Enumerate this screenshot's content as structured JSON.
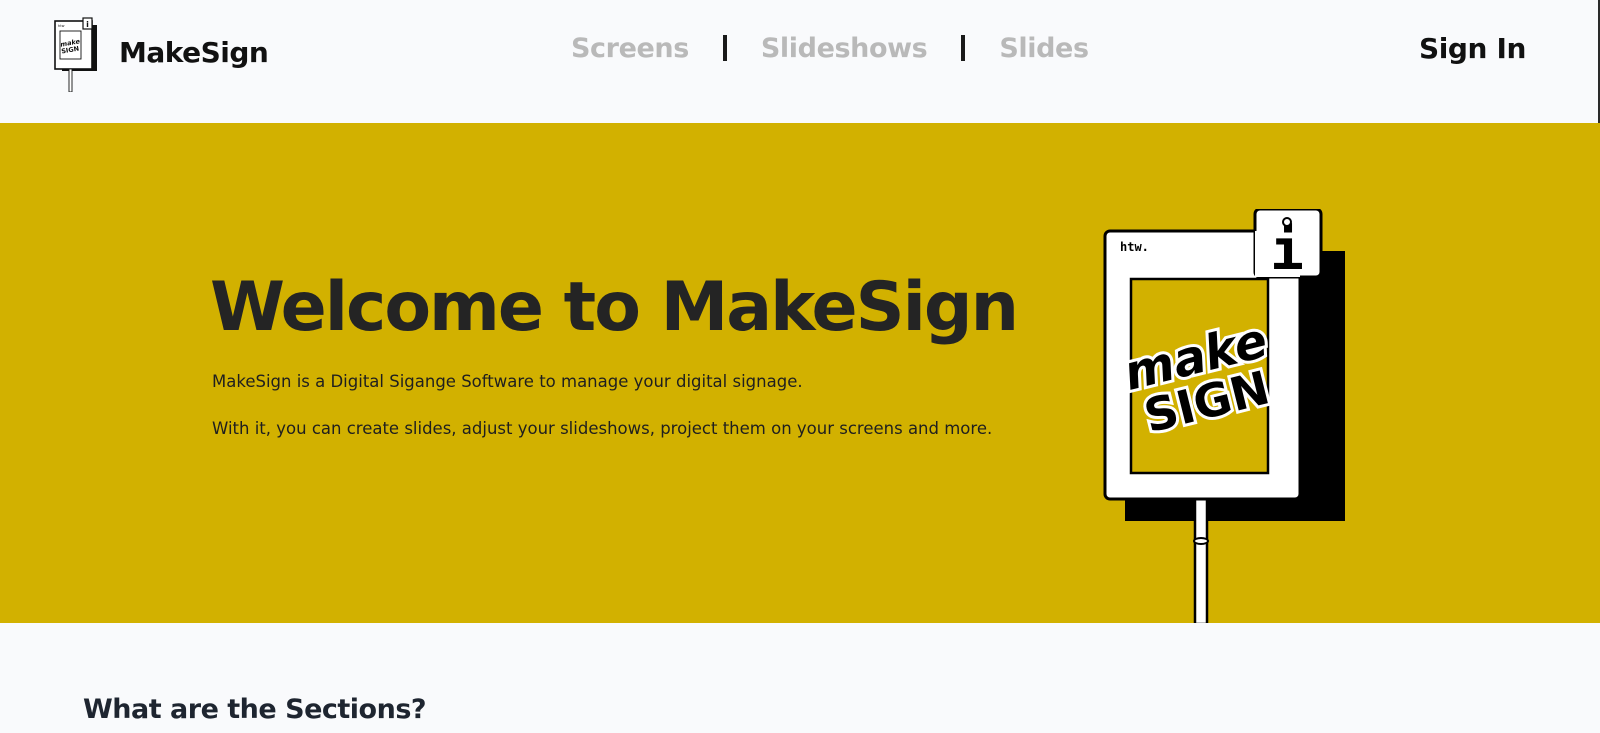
{
  "header": {
    "brand": {
      "name": "MakeSign",
      "logo_icon": "makesign-sign-logo-icon"
    },
    "nav": {
      "items": [
        {
          "label": "Screens"
        },
        {
          "label": "Slideshows"
        },
        {
          "label": "Slides"
        }
      ]
    },
    "sign_in_label": "Sign In"
  },
  "hero": {
    "title": "Welcome to MakeSign",
    "paragraph_1": "MakeSign is a Digital Sigange Software to manage your digital signage.",
    "paragraph_2": "With it, you can create slides, adjust your slideshows, project them on your screens and more.",
    "background_color": "#d2b100",
    "illustration": {
      "icon": "signpost-illustration-icon",
      "corner_text": "htw.",
      "info_glyph": "i",
      "sign_text_line1": "make",
      "sign_text_line2": "SIGN"
    }
  },
  "sections": {
    "heading": "What are the Sections?"
  }
}
